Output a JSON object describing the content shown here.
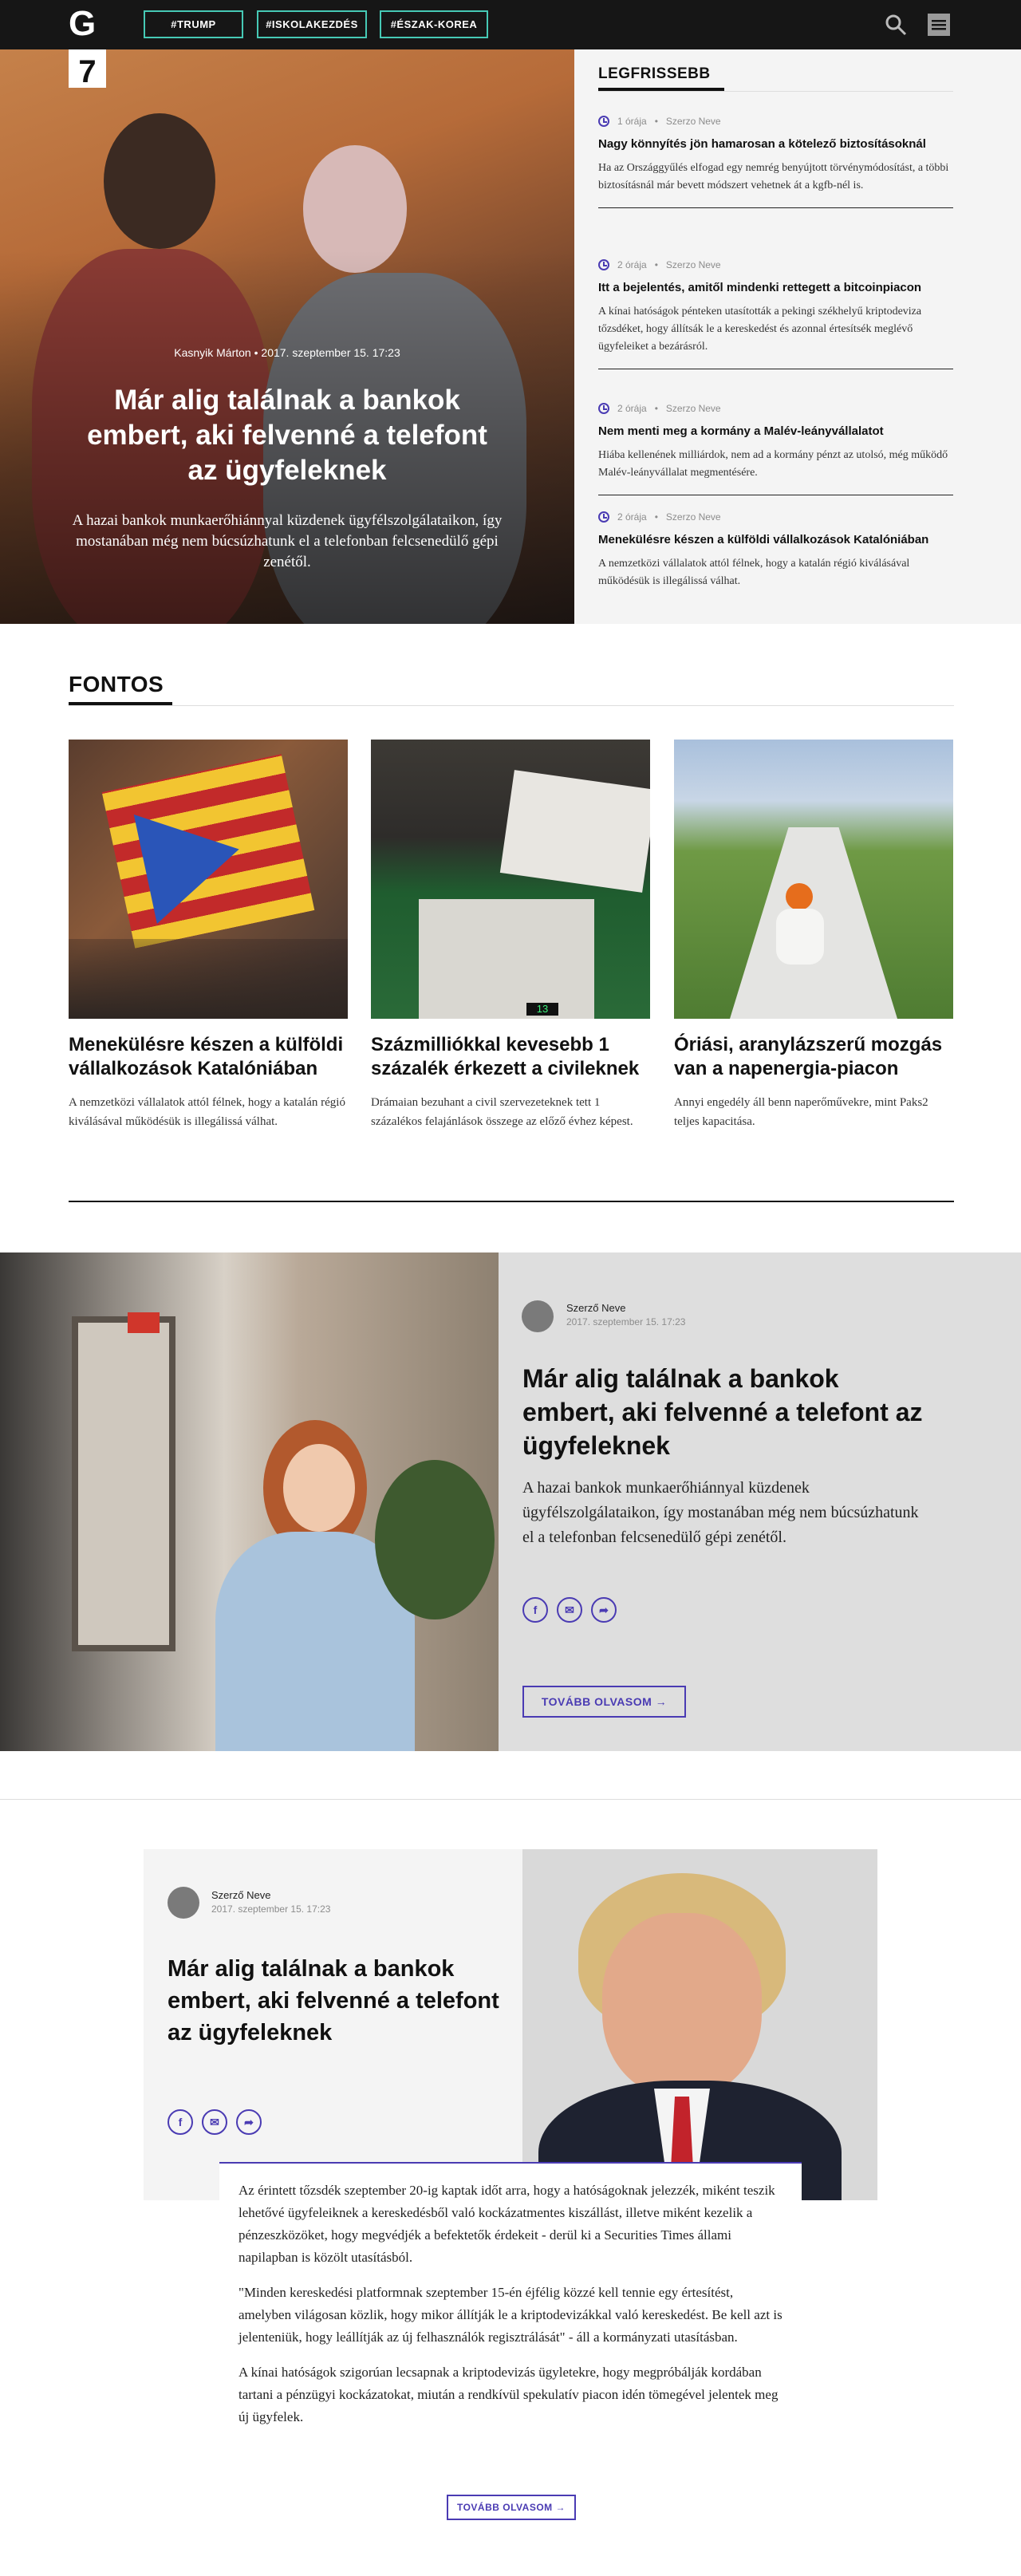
{
  "nav": {
    "logo": "G",
    "tags": [
      "#TRUMP",
      "#ISKOLAKEZDÉS",
      "#ÉSZAK-KOREA"
    ]
  },
  "hero": {
    "badge": "7",
    "author": "Kasnyik Márton",
    "date": "2017. szeptember 15. 17:23",
    "title": "Már alig találnak a bankok embert, aki felvenné a telefont az ügyfeleknek",
    "lead": "A hazai bankok munkaerőhiánnyal küzdenek ügyfélszolgálataikon, így mostanában még nem búcsúzhatunk el a telefonban felcsenedülő gépi zenétől."
  },
  "latest": {
    "heading": "LEGFRISSEBB",
    "items": [
      {
        "time": "1 órája",
        "author": "Szerzo Neve",
        "title": "Nagy könnyítés jön hamarosan a kötelező biztosításoknál",
        "lead": "Ha az Országgyűlés elfogad egy nemrég benyújtott törvénymódosítást, a többi biztosításnál már bevett módszert vehetnek át a kgfb-nél is."
      },
      {
        "time": "2 órája",
        "author": "Szerzo Neve",
        "title": "Itt a bejelentés, amitől mindenki rettegett a bitcoinpiacon",
        "lead": "A kínai hatóságok pénteken utasították a pekingi székhelyű kriptodeviza tőzsdéket, hogy állítsák le a kereskedést és azonnal értesítsék meglévő ügyfeleiket a bezárásról."
      },
      {
        "time": "2 órája",
        "author": "Szerzo Neve",
        "title": "Nem menti meg a kormány a Malév-leányvállalatot",
        "lead": "Hiába kellenének milliárdok, nem ad a kormány pénzt az utolsó, még működő Malév-leányvállalat megmentésére."
      },
      {
        "time": "2 órája",
        "author": "Szerzo Neve",
        "title": "Menekülésre készen a külföldi vállalkozások Katalóniában",
        "lead": "A nemzetközi vállalatok attól félnek, hogy a katalán régió kiválásával működésük is illegálissá válhat."
      }
    ]
  },
  "important": {
    "heading": "FONTOS",
    "cards": [
      {
        "title": "Menekülésre készen a külföldi vállalkozások Katalóniában",
        "lead": "A nemzetközi vállalatok attól félnek, hogy a katalán régió kiválásával működésük is illegálissá válhat."
      },
      {
        "title": "Százmilliókkal kevesebb 1 százalék érkezett a civileknek",
        "lead": "Drámaian bezuhant a civil szervezeteknek tett 1 százalékos felajánlások összege az előző évhez képest."
      },
      {
        "title": "Óriási, aranylázszerű mozgás van a napenergia-piacon",
        "lead": "Annyi engedély áll benn naperőművekre, mint Paks2 teljes kapacitása."
      }
    ]
  },
  "feature": {
    "author": "Szerző Neve",
    "date": "2017. szeptember 15. 17:23",
    "title": "Már alig találnak a bankok embert, aki felvenné a telefont az ügyfeleknek",
    "lead": "A hazai bankok munkaerőhiánnyal küzdenek ügyfélszolgálataikon, így mostanában még nem búcsúzhatunk el a telefonban felcsenedülő gépi zenétől.",
    "more": "TOVÁBB OLVASOM →"
  },
  "article": {
    "author": "Szerző Neve",
    "date": "2017. szeptember 15. 17:23",
    "title": "Már alig találnak a bankok embert, aki felvenné a telefont az ügyfeleknek",
    "paragraphs": [
      "Az érintett tőzsdék szeptember 20-ig kaptak időt arra, hogy a hatóságoknak jelezzék, miként teszik lehetővé ügyfeleiknek a kereskedésből való kockázatmentes kiszállást, illetve miként kezelik a pénzeszközöket, hogy megvédjék a befektetők érdekeit - derül ki a Securities Times állami napilapban is közölt utasításból.",
      "\"Minden kereskedési platformnak szeptember 15-én éjfélig közzé kell tennie egy értesítést, amelyben világosan közlik, hogy mikor állítják le a kriptodevizákkal való kereskedést. Be kell azt is jelenteniük, hogy leállítják az új felhasználók regisztrálását\" - áll a kormányzati utasításban.",
      "A kínai hatóságok szigorúan lecsapnak a kriptodevizás ügyletekre, hogy megpróbálják kordában tartani a pénzügyi kockázatokat, miután a rendkívül spekulatív piacon idén tömegével jelentek meg új ügyfelek."
    ],
    "more": "TOVÁBB OLVASOM →"
  },
  "colors": {
    "accent": "#4a3bb3",
    "tag_border": "#46c9b5",
    "nav_bg": "#161616"
  }
}
